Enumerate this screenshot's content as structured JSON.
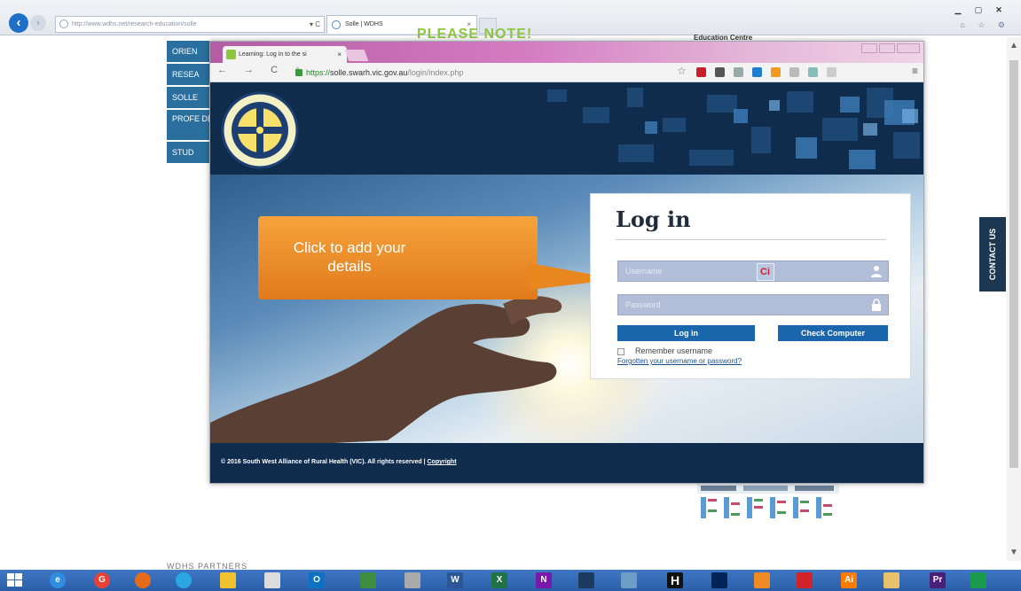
{
  "ie": {
    "address": "http://www.wdhs.net/research-education/solle",
    "address_domain": "wdhs.net",
    "address_ctrls": "▾ C",
    "tab_title": "Solle | WDHS",
    "tab_close": "×",
    "win_min": "▁",
    "win_max": "▢",
    "win_close": "✕"
  },
  "background_site": {
    "please_note": "PLEASE NOTE!",
    "edu_centre": "Education Centre",
    "nav": [
      "ORIEN",
      "RESEA",
      "SOLLE",
      "PROFE DEVEL",
      "STUD"
    ],
    "partners": "WDHS PARTNERS",
    "contact_us": "CONTACT US"
  },
  "chrome": {
    "tab_title": "Learning: Log in to the si",
    "tab_close": "×",
    "url_https": "https://",
    "url_domain": "solle.swarh.vic.gov.au",
    "url_path": "/login/index.php",
    "nav_glyphs": "← → C ⌂",
    "star": "☆",
    "menu": "≡"
  },
  "login": {
    "title": "Log in",
    "username_placeholder": "Username",
    "password_placeholder": "Password",
    "login_button": "Log in",
    "check_button": "Check Computer",
    "remember": "Remember username",
    "forgot": "Forgotten your username or password?",
    "lastpass": "Ci"
  },
  "callout": {
    "line1": "Click to add your",
    "line2": "details"
  },
  "footer": {
    "copyright": "© 2016 South West Alliance of Rural Health (VIC). All rights reserved |",
    "link": "Copyright"
  },
  "taskbar": {
    "icons": [
      "windows-start",
      "ie",
      "chrome",
      "firefox",
      "skype",
      "media",
      "file-explorer",
      "camera",
      "outlook",
      "app",
      "app",
      "word",
      "excel",
      "onenote",
      "app",
      "app",
      "h-app",
      "powershell",
      "app",
      "acrobat",
      "illustrator",
      "app",
      "premiere",
      "app"
    ]
  },
  "colors": {
    "header_navy": "#0f2c4d",
    "button_blue": "#1a66ac",
    "callout_orange": "#f08a24",
    "nav_blue": "#2a6f9d"
  }
}
